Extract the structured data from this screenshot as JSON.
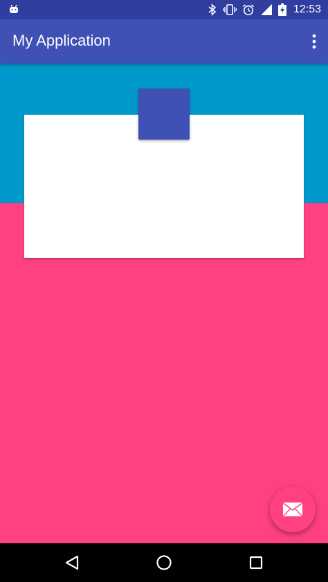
{
  "status_bar": {
    "time": "12:53",
    "icons": [
      "android-notification-icon",
      "bluetooth-icon",
      "vibrate-icon",
      "alarm-icon",
      "signal-icon",
      "battery-charging-icon"
    ]
  },
  "app_bar": {
    "title": "My Application",
    "menu_icon": "overflow-menu-icon"
  },
  "colors": {
    "primary": "#3F51B5",
    "primary_dark": "#303F9F",
    "accent": "#FF4081",
    "blue_band": "#0099CC",
    "card": "#FFFFFF"
  },
  "fab": {
    "icon": "email-icon"
  },
  "nav_bar": {
    "buttons": [
      "back-icon",
      "home-icon",
      "recents-icon"
    ]
  }
}
